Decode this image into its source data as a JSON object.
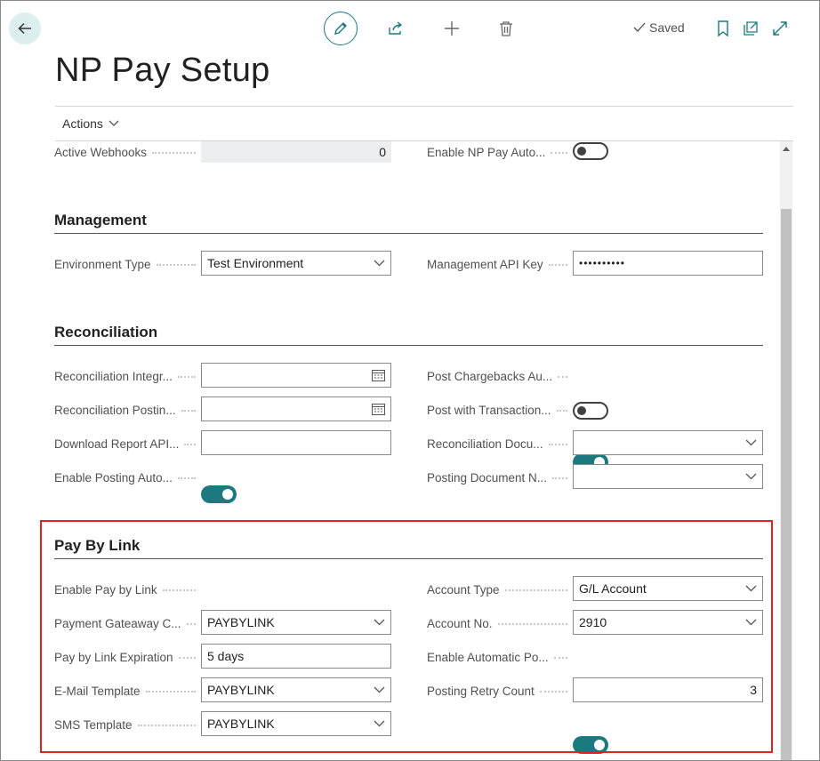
{
  "header": {
    "title": "NP Pay Setup",
    "saved_label": "Saved",
    "actions_label": "Actions"
  },
  "top_row": {
    "active_webhooks": {
      "label": "Active Webhooks",
      "value": "0"
    },
    "enable_np_pay": {
      "label": "Enable NP Pay Auto...",
      "on": false
    }
  },
  "management": {
    "title": "Management",
    "environment_type": {
      "label": "Environment Type",
      "value": "Test Environment"
    },
    "api_key": {
      "label": "Management API Key",
      "value": "••••••••••"
    }
  },
  "reconciliation": {
    "title": "Reconciliation",
    "left": [
      {
        "label": "Reconciliation Integr...",
        "value": "",
        "kind": "date"
      },
      {
        "label": "Reconciliation Postin...",
        "value": "",
        "kind": "date"
      },
      {
        "label": "Download Report API...",
        "value": "",
        "kind": "text"
      },
      {
        "label": "Enable Posting Auto...",
        "kind": "toggle",
        "on": true
      }
    ],
    "right": [
      {
        "label": "Post Chargebacks Au...",
        "kind": "toggle",
        "on": false
      },
      {
        "label": "Post with Transaction...",
        "kind": "toggle",
        "on": true
      },
      {
        "label": "Reconciliation Docu...",
        "value": "",
        "kind": "select"
      },
      {
        "label": "Posting Document N...",
        "value": "",
        "kind": "select"
      }
    ]
  },
  "pay_by_link": {
    "title": "Pay By Link",
    "left": [
      {
        "label": "Enable Pay by Link",
        "kind": "toggle",
        "on": true
      },
      {
        "label": "Payment Gateaway C...",
        "value": "PAYBYLINK",
        "kind": "select"
      },
      {
        "label": "Pay by Link Expiration",
        "value": "5 days",
        "kind": "text"
      },
      {
        "label": "E-Mail Template",
        "value": "PAYBYLINK",
        "kind": "select"
      },
      {
        "label": "SMS Template",
        "value": "PAYBYLINK",
        "kind": "select"
      }
    ],
    "right": [
      {
        "label": "Account Type",
        "value": "G/L Account",
        "kind": "select"
      },
      {
        "label": "Account No.",
        "value": "2910",
        "kind": "select"
      },
      {
        "label": "Enable Automatic Po...",
        "kind": "toggle",
        "on": true
      },
      {
        "label": "Posting Retry Count",
        "value": "3",
        "kind": "number"
      }
    ]
  },
  "colors": {
    "accent": "#1c7a7e",
    "highlight": "#e0231c"
  },
  "icons": [
    "back-arrow-icon",
    "pencil-icon",
    "share-icon",
    "plus-icon",
    "trash-icon",
    "check-icon",
    "bookmark-icon",
    "open-new-window-icon",
    "expand-icon",
    "chevron-down-icon",
    "calendar-icon"
  ]
}
